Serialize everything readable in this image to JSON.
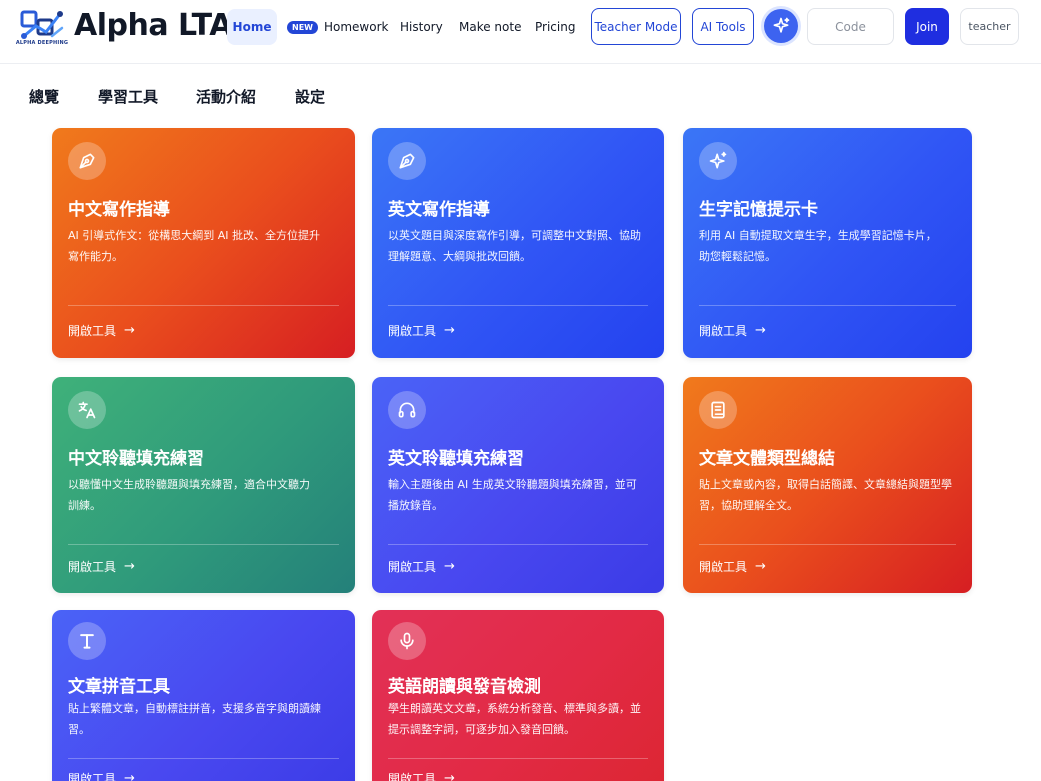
{
  "header": {
    "logo_caption": "ALPHA DEEPHING",
    "brand": "Alpha LTA",
    "nav": {
      "home": "Home",
      "new_badge": "NEW",
      "homework": "Homework",
      "history": "History",
      "make_note": "Make note",
      "pricing": "Pricing"
    },
    "teacher_mode": "Teacher Mode",
    "ai_tools": "AI Tools",
    "code_placeholder": "Code",
    "join": "Join",
    "user": "teacher"
  },
  "tabs": [
    "總覽",
    "學習工具",
    "活動介紹",
    "設定"
  ],
  "cards": [
    {
      "icon": "pen-nib-icon",
      "title": "中文寫作指導",
      "desc_line1": "AI 引導式作文：從構思大綱到 AI 批改、全方位提升",
      "desc_line2": "寫作能力。",
      "cta": "開啟工具"
    },
    {
      "icon": "pen-nib-icon",
      "title": "英文寫作指導",
      "desc_line1": "以英文題目與深度寫作引導，可調整中文對照、協助",
      "desc_line2": "理解題意、大綱與批改回饋。",
      "cta": "開啟工具"
    },
    {
      "icon": "sparkles-icon",
      "title": "生字記憶提示卡",
      "desc_line1": "利用 AI 自動提取文章生字，生成學習記憶卡片，",
      "desc_line2": "助您輕鬆記憶。",
      "cta": "開啟工具"
    },
    {
      "icon": "translate-icon",
      "title": "中文聆聽填充練習",
      "desc_line1": "以聽懂中文生成聆聽題與填充練習，適合中文聽力",
      "desc_line2": "訓練。",
      "cta": "開啟工具"
    },
    {
      "icon": "headphones-icon",
      "title": "英文聆聽填充練習",
      "desc_line1": "輸入主題後由 AI 生成英文聆聽題與填充練習，並可",
      "desc_line2": "播放錄音。",
      "cta": "開啟工具"
    },
    {
      "icon": "scroll-icon",
      "title": "文章文體類型總結",
      "desc_line1": "貼上文章或內容，取得白話簡譯、文章總結與題型學",
      "desc_line2": "習，協助理解全文。",
      "cta": "開啟工具"
    },
    {
      "icon": "type-t-icon",
      "title": "文章拼音工具",
      "desc_line1": "貼上繁體文章，自動標註拼音，支援多音字與朗讀練",
      "desc_line2": "習。",
      "cta": "開啟工具"
    },
    {
      "icon": "microphone-icon",
      "title": "英語朗讀與發音檢測",
      "desc_line1": "學生朗讀英文文章，系統分析發音、標準與多讀，並",
      "desc_line2": "提示調整字詞，可逐步加入發音回饋。",
      "cta": "開啟工具"
    }
  ],
  "colors": {
    "primary": "#2346d6",
    "orange_card": "#ea4f1d",
    "blue_card": "#3055f5",
    "green_card": "#2f9a7b",
    "indigo_card": "#4948f0",
    "pink_card": "#e22a45"
  }
}
